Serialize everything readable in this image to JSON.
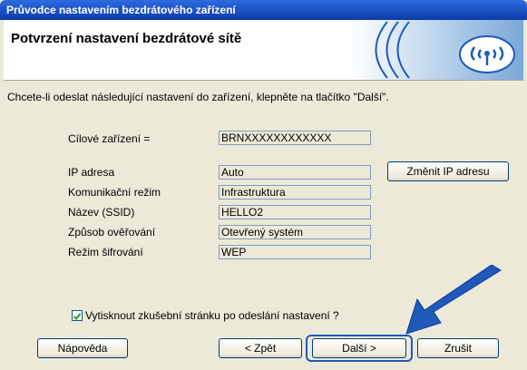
{
  "window": {
    "title": "Průvodce nastavením bezdrátového zařízení"
  },
  "header": {
    "title": "Potvrzení nastavení bezdrátové sítě"
  },
  "instruction": "Chcete-li odeslat následující nastavení do zařízení, klepněte na tlačítko \"Další\".",
  "target": {
    "label": "Cílové zařízení =",
    "value": "BRNXXXXXXXXXXXX"
  },
  "settings": [
    {
      "label": "IP adresa",
      "value": "Auto"
    },
    {
      "label": "Komunikační režim",
      "value": "Infrastruktura"
    },
    {
      "label": "Název (SSID)",
      "value": "HELLO2"
    },
    {
      "label": "Způsob ověřování",
      "value": "Otevřený systém"
    },
    {
      "label": "Režim šifrování",
      "value": "WEP"
    }
  ],
  "buttons": {
    "change_ip": "Změnit IP adresu",
    "help": "Nápověda",
    "back": "< Zpět",
    "next": "Další >",
    "cancel": "Zrušit"
  },
  "print_checkbox": {
    "label": "Vytisknout zkušební stránku po odeslání nastavení ?",
    "checked": true
  },
  "colors": {
    "accent": "#1e5bb8",
    "titlebar": "#1a4fc2"
  }
}
